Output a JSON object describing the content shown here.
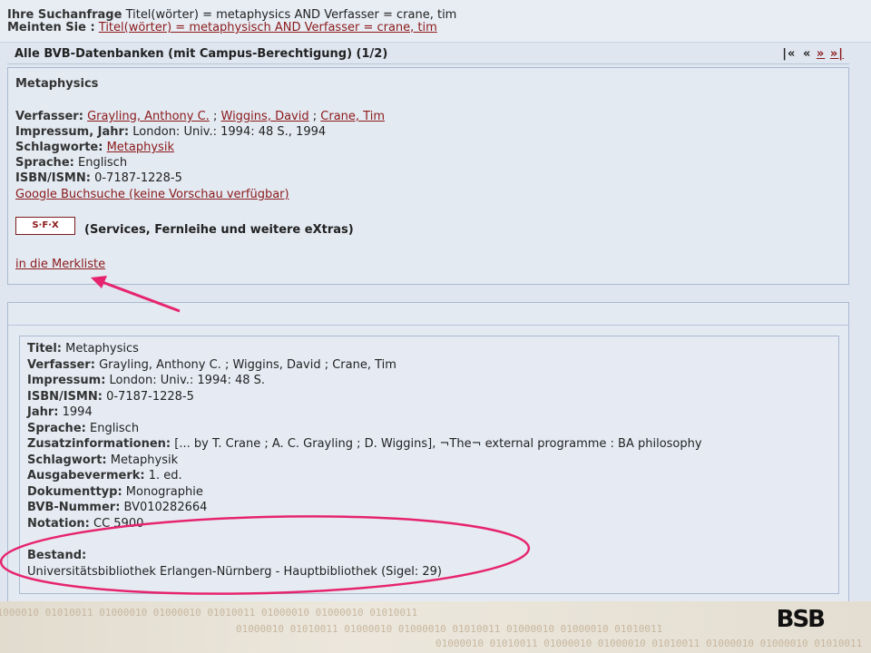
{
  "query": {
    "label1": "Ihre Suchanfrage",
    "text1": "Titel(wörter) = metaphysics AND Verfasser = crane, tim",
    "label2": "Meinten Sie :",
    "suggestion": "Titel(wörter) = metaphysisch AND Verfasser = crane, tim"
  },
  "db": {
    "title": "Alle BVB-Datenbanken (mit Campus-Berechtigung) (1/2)",
    "pager": [
      "|«",
      "«",
      "»",
      "»|"
    ]
  },
  "record1": {
    "title": "Metaphysics",
    "verfasser_label": "Verfasser:",
    "authors": [
      "Grayling, Anthony C.",
      "Wiggins, David",
      "Crane, Tim"
    ],
    "sep": ";",
    "impressum_label": "Impressum, Jahr:",
    "impressum": "London: Univ.: 1994: 48 S., 1994",
    "schlagworte_label": "Schlagworte:",
    "schlagworte": "Metaphysik",
    "sprache_label": "Sprache:",
    "sprache": "Englisch",
    "isbn_label": "ISBN/ISMN:",
    "isbn": "0-7187-1228-5",
    "google": "Google Buchsuche (keine Vorschau verfügbar)",
    "sfx_button": "S·F·X",
    "sfx_text": "(Services, Fernleihe und weitere eXtras)",
    "merkliste": "in die Merkliste"
  },
  "record2": {
    "fields": [
      {
        "label": "Titel:",
        "value": "Metaphysics"
      },
      {
        "label": "Verfasser:",
        "value": "Grayling, Anthony C. ; Wiggins, David ; Crane, Tim"
      },
      {
        "label": "Impressum:",
        "value": "London: Univ.: 1994: 48 S."
      },
      {
        "label": "ISBN/ISMN:",
        "value": "0-7187-1228-5"
      },
      {
        "label": "Jahr:",
        "value": "1994"
      },
      {
        "label": "Sprache:",
        "value": "Englisch"
      },
      {
        "label": "Zusatzinformationen:",
        "value": "[... by T. Crane ; A. C. Grayling ; D. Wiggins], ¬The¬ external programme : BA philosophy"
      },
      {
        "label": "Schlagwort:",
        "value": "Metaphysik"
      },
      {
        "label": "Ausgabevermerk:",
        "value": "1. ed."
      },
      {
        "label": "Dokumenttyp:",
        "value": "Monographie"
      },
      {
        "label": "BVB-Nummer:",
        "value": "BV010282664"
      },
      {
        "label": "Notation:",
        "value": "CC 5900"
      }
    ],
    "bestand_label": "Bestand:",
    "bestand": "Universitätsbibliothek Erlangen-Nürnberg - Hauptbibliothek (Sigel: 29)"
  },
  "footer": {
    "logo": "BSB",
    "binary": "01000010 01010011 01000010 01000010 01010011 01000010 01000010 01010011"
  },
  "colors": {
    "link": "#8b1a1a",
    "annotation": "#e6246e",
    "background": "#dfe6f0"
  }
}
